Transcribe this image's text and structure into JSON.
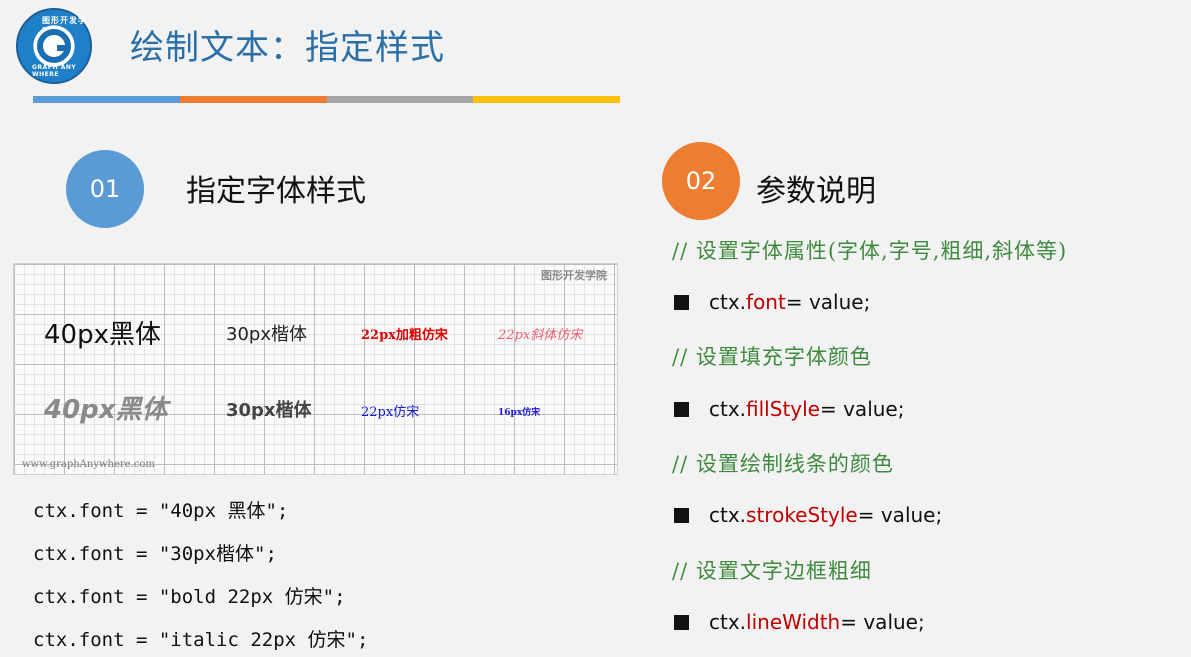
{
  "logo": {
    "text_top": "图形开发学院",
    "text_bottom": "GRAPH ANY WHERE"
  },
  "title": "绘制文本：指定样式",
  "colorbar": [
    "#5b9bd5",
    "#ed7d31",
    "#a5a5a5",
    "#ffc000"
  ],
  "section1": {
    "number": "01",
    "title": "指定字体样式"
  },
  "section2": {
    "number": "02",
    "title": "参数说明"
  },
  "demo": {
    "watermark": "图形开发学院",
    "url": "www.graphAnywhere.com",
    "row1": [
      "40px黑体",
      "30px楷体",
      "22px加粗仿宋",
      "22px斜体仿宋"
    ],
    "row2": [
      "40px黑体",
      "30px楷体",
      "22px仿宋",
      "16px仿宋"
    ]
  },
  "code_lines": [
    "ctx.font = \"40px 黑体\";",
    "ctx.font = \"30px楷体\";",
    "ctx.font = \"bold 22px 仿宋\";",
    "ctx.font = \"italic 22px 仿宋\";"
  ],
  "params": [
    {
      "comment": "// 设置字体属性(字体,字号,粗细,斜体等)",
      "prefix": "ctx.",
      "keyword": "font",
      "suffix": " = value;"
    },
    {
      "comment": "// 设置填充字体颜色",
      "prefix": "ctx.",
      "keyword": "fillStyle",
      "suffix": "= value;"
    },
    {
      "comment": "// 设置绘制线条的颜色",
      "prefix": "ctx.",
      "keyword": "strokeStyle",
      "suffix": "= value;"
    },
    {
      "comment": "// 设置文字边框粗细",
      "prefix": "ctx.",
      "keyword": "lineWidth",
      "suffix": "= value;"
    }
  ],
  "colors": {
    "title": "#2b6fa7",
    "comment": "#3f8a3f",
    "keyword": "#c00000"
  }
}
